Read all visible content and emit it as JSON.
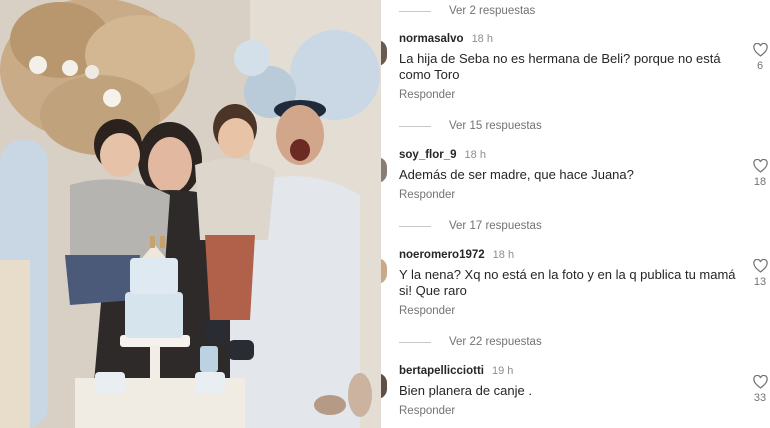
{
  "post": {
    "photo_alt": "family-birthday-photo"
  },
  "comments": [
    {
      "replies_label": "Ver 2 respuestas"
    },
    {
      "username": "normasalvo",
      "time": "18 h",
      "text": "La hija de Seba no es hermana de Beli? porque no está como Toro",
      "reply_label": "Responder",
      "likes": "6",
      "replies_label": "Ver 15 respuestas"
    },
    {
      "username": "soy_flor_9",
      "time": "18 h",
      "text": "Además de ser madre, que hace Juana?",
      "reply_label": "Responder",
      "likes": "18",
      "replies_label": "Ver 17 respuestas"
    },
    {
      "username": "noeromero1972",
      "time": "18 h",
      "text": "Y la nena? Xq no está en la foto y en la q publica tu mamá si! Que raro",
      "reply_label": "Responder",
      "likes": "13",
      "replies_label": "Ver 22 respuestas"
    },
    {
      "username": "bertapellicciotti",
      "time": "19 h",
      "text": "Bien planera de canje .",
      "reply_label": "Responder",
      "likes": "33"
    }
  ],
  "colors": {
    "text": "#262626",
    "secondary": "#737373",
    "divider": "#c7c7c7"
  },
  "icons": {
    "like": "heart-outline-icon"
  }
}
